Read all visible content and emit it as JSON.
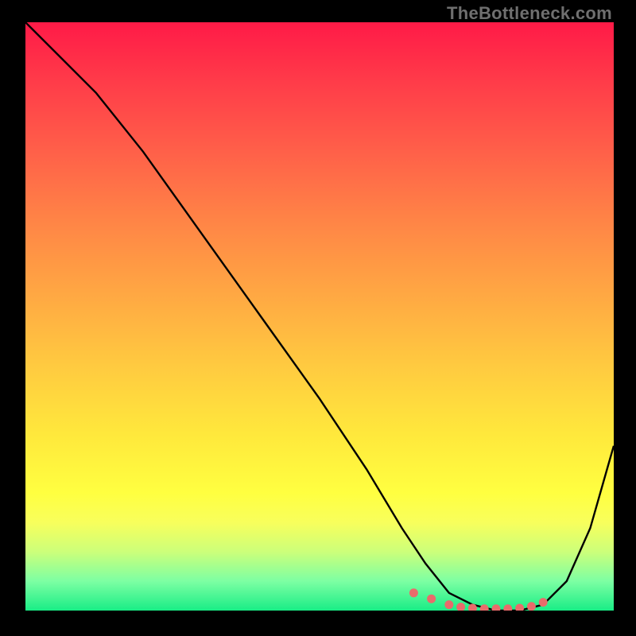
{
  "watermark": "TheBottleneck.com",
  "chart_data": {
    "type": "line",
    "title": "",
    "xlabel": "",
    "ylabel": "",
    "xlim": [
      0,
      100
    ],
    "ylim": [
      0,
      100
    ],
    "grid": false,
    "legend": false,
    "series": [
      {
        "name": "curve",
        "x": [
          0,
          6,
          12,
          20,
          30,
          40,
          50,
          58,
          64,
          68,
          72,
          76,
          80,
          84,
          88,
          92,
          96,
          100
        ],
        "values": [
          100,
          94,
          88,
          78,
          64,
          50,
          36,
          24,
          14,
          8,
          3,
          1,
          0,
          0,
          1,
          5,
          14,
          28
        ]
      }
    ],
    "markers": {
      "name": "highlight-dots",
      "color": "#e96b6b",
      "x": [
        66,
        69,
        72,
        74,
        76,
        78,
        80,
        82,
        84,
        86,
        88
      ],
      "values": [
        3,
        2,
        1,
        0.6,
        0.4,
        0.3,
        0.3,
        0.3,
        0.4,
        0.7,
        1.4
      ]
    },
    "background_gradient": {
      "stops": [
        {
          "pos": 0,
          "color": "#ff1a47"
        },
        {
          "pos": 10,
          "color": "#ff3b49"
        },
        {
          "pos": 22,
          "color": "#ff6049"
        },
        {
          "pos": 34,
          "color": "#ff8546"
        },
        {
          "pos": 46,
          "color": "#ffa743"
        },
        {
          "pos": 58,
          "color": "#ffc940"
        },
        {
          "pos": 70,
          "color": "#ffe83c"
        },
        {
          "pos": 80,
          "color": "#ffff40"
        },
        {
          "pos": 85,
          "color": "#f8ff5c"
        },
        {
          "pos": 90,
          "color": "#ccff7a"
        },
        {
          "pos": 95,
          "color": "#7dffa3"
        },
        {
          "pos": 100,
          "color": "#19ed86"
        }
      ]
    }
  }
}
